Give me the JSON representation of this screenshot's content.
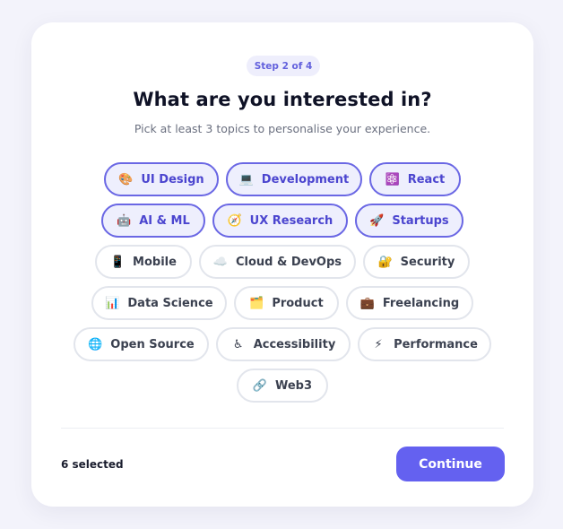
{
  "header": {
    "step": "Step 2 of 4",
    "title": "What are you interested in?",
    "subtitle": "Pick at least 3 topics to personalise your experience."
  },
  "topics": [
    {
      "label": "UI Design",
      "icon": "🎨",
      "icon_name": "palette-icon",
      "selected": true
    },
    {
      "label": "Development",
      "icon": "💻",
      "icon_name": "laptop-icon",
      "selected": true
    },
    {
      "label": "React",
      "icon": "⚛️",
      "icon_name": "atom-icon",
      "selected": true
    },
    {
      "label": "AI & ML",
      "icon": "🤖",
      "icon_name": "robot-icon",
      "selected": true
    },
    {
      "label": "UX Research",
      "icon": "🧭",
      "icon_name": "compass-icon",
      "selected": true
    },
    {
      "label": "Startups",
      "icon": "🚀",
      "icon_name": "rocket-icon",
      "selected": true
    },
    {
      "label": "Mobile",
      "icon": "📱",
      "icon_name": "mobile-phone-icon",
      "selected": false
    },
    {
      "label": "Cloud & DevOps",
      "icon": "☁️",
      "icon_name": "cloud-icon",
      "selected": false
    },
    {
      "label": "Security",
      "icon": "🔐",
      "icon_name": "lock-icon",
      "selected": false
    },
    {
      "label": "Data Science",
      "icon": "📊",
      "icon_name": "bar-chart-icon",
      "selected": false
    },
    {
      "label": "Product",
      "icon": "🗂️",
      "icon_name": "folder-icon",
      "selected": false
    },
    {
      "label": "Freelancing",
      "icon": "💼",
      "icon_name": "briefcase-icon",
      "selected": false
    },
    {
      "label": "Open Source",
      "icon": "🌐",
      "icon_name": "globe-icon",
      "selected": false
    },
    {
      "label": "Accessibility",
      "icon": "♿",
      "icon_name": "accessibility-icon",
      "selected": false
    },
    {
      "label": "Performance",
      "icon": "⚡",
      "icon_name": "lightning-icon",
      "selected": false
    },
    {
      "label": "Web3",
      "icon": "🔗",
      "icon_name": "link-icon",
      "selected": false
    }
  ],
  "footer": {
    "selected_text": "6 selected",
    "continue_label": "Continue"
  },
  "colors": {
    "accent": "#6461f0",
    "selected_border": "#6a67e4",
    "selected_bg": "#eeeffd",
    "selected_text": "#4b45cf"
  }
}
